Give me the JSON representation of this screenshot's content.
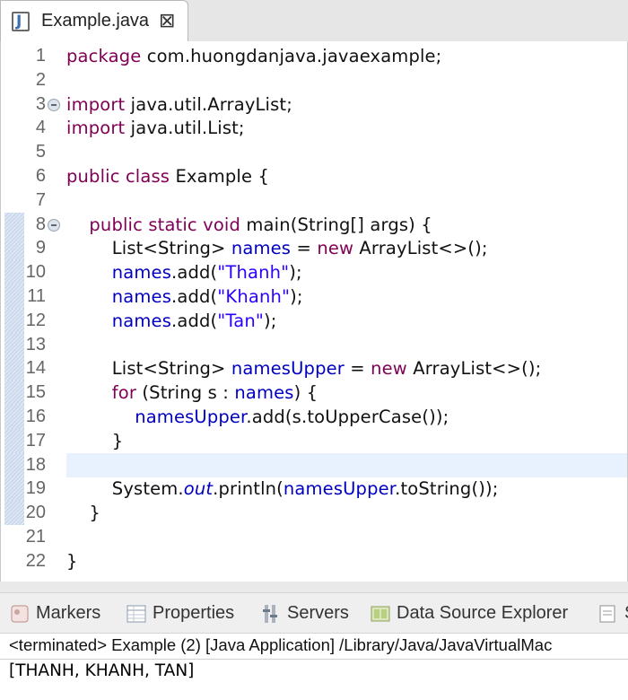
{
  "editor": {
    "tab_title": "Example.java",
    "close_glyph": "⊠",
    "lines": [
      {
        "n": "1",
        "code": "package com.huongdanjava.javaexample;"
      },
      {
        "n": "2",
        "code": ""
      },
      {
        "n": "3",
        "code": "import java.util.ArrayList;"
      },
      {
        "n": "4",
        "code": "import java.util.List;"
      },
      {
        "n": "5",
        "code": ""
      },
      {
        "n": "6",
        "code": "public class Example {"
      },
      {
        "n": "7",
        "code": ""
      },
      {
        "n": "8",
        "code": "    public static void main(String[] args) {"
      },
      {
        "n": "9",
        "code": "        List<String> names = new ArrayList<>();"
      },
      {
        "n": "10",
        "code": "        names.add(\"Thanh\");"
      },
      {
        "n": "11",
        "code": "        names.add(\"Khanh\");"
      },
      {
        "n": "12",
        "code": "        names.add(\"Tan\");"
      },
      {
        "n": "13",
        "code": ""
      },
      {
        "n": "14",
        "code": "        List<String> namesUpper = new ArrayList<>();"
      },
      {
        "n": "15",
        "code": "        for (String s : names) {"
      },
      {
        "n": "16",
        "code": "            namesUpper.add(s.toUpperCase());"
      },
      {
        "n": "17",
        "code": "        }"
      },
      {
        "n": "18",
        "code": ""
      },
      {
        "n": "19",
        "code": "        System.out.println(namesUpper.toString());"
      },
      {
        "n": "20",
        "code": "    }"
      },
      {
        "n": "21",
        "code": ""
      },
      {
        "n": "22",
        "code": "}"
      }
    ],
    "current_line": "18",
    "fold_lines": [
      "3",
      "8"
    ],
    "marked_lines": [
      "8",
      "9",
      "10",
      "11",
      "12",
      "13",
      "14",
      "15",
      "16",
      "17",
      "18",
      "19",
      "20"
    ]
  },
  "views": {
    "tabs": [
      {
        "label": "Markers",
        "icon": "markers-icon"
      },
      {
        "label": "Properties",
        "icon": "properties-icon"
      },
      {
        "label": "Servers",
        "icon": "servers-icon"
      },
      {
        "label": "Data Source Explorer",
        "icon": "data-source-explorer-icon"
      },
      {
        "label": "S",
        "icon": "snippets-icon"
      }
    ]
  },
  "console": {
    "header": "<terminated> Example (2) [Java Application] /Library/Java/JavaVirtualMac",
    "output": "[THANH, KHANH, TAN]"
  },
  "colors": {
    "keyword": "#7f0055",
    "string": "#2a00ff",
    "field": "#0000c0",
    "current_line_bg": "#e8f2fe"
  }
}
